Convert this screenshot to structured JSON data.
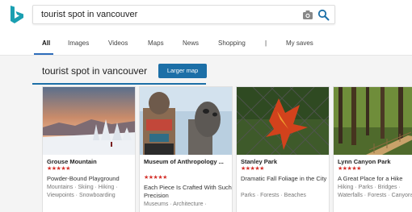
{
  "search": {
    "query": "tourist spot in vancouver"
  },
  "tabs": [
    {
      "label": "All"
    },
    {
      "label": "Images"
    },
    {
      "label": "Videos"
    },
    {
      "label": "Maps"
    },
    {
      "label": "News"
    },
    {
      "label": "Shopping"
    },
    {
      "label": "|"
    },
    {
      "label": "My saves"
    }
  ],
  "results": {
    "title": "tourist spot in vancouver",
    "larger_map_label": "Larger map",
    "cards": [
      {
        "name": "Grouse Mountain",
        "stars": "★★★★★",
        "desc": "Powder-Bound Playground",
        "tags": "Mountains · Skiing · Hiking · Viewpoints · Snowboarding"
      },
      {
        "name": "Museum of Anthropology ...",
        "stars": "★★★★★",
        "desc": "Each Piece Is Crafted With Such Precision",
        "tags": "Museums · Architecture ·"
      },
      {
        "name": "Stanley Park",
        "stars": "★★★★★",
        "desc": "Dramatic Fall Foliage in the City",
        "tags": "Parks · Forests · Beaches"
      },
      {
        "name": "Lynn Canyon Park",
        "stars": "★★★★★",
        "desc": "A Great Place for a Hike",
        "tags": "Hiking · Parks · Bridges · Waterfalls · Forests · Canyons"
      }
    ]
  },
  "colors": {
    "accent": "#1c6fa7",
    "tab_underline": "#2e6dbb",
    "stars": "#d4302a"
  },
  "icons": [
    "bing-logo-icon",
    "camera-icon",
    "search-icon"
  ]
}
